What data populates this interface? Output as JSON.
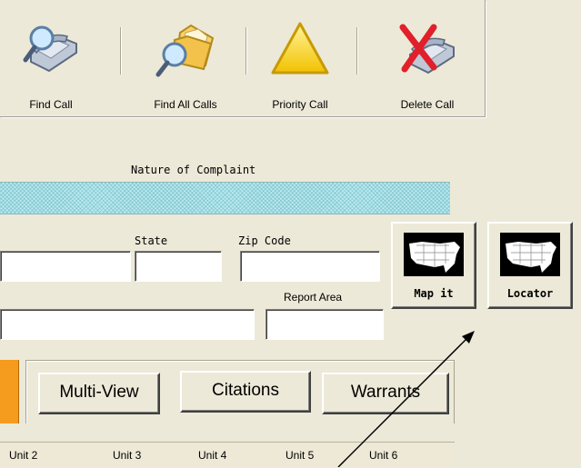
{
  "toolbar": {
    "buttons": [
      {
        "label": "Find Call",
        "icon": "phone-magnifier-icon"
      },
      {
        "label": "Find All Calls",
        "icon": "folder-magnifier-icon"
      },
      {
        "label": "Priority Call",
        "icon": "warning-triangle-icon"
      },
      {
        "label": "Delete Call",
        "icon": "phone-delete-icon"
      }
    ]
  },
  "form": {
    "nature_of_complaint_label": "Nature of Complaint",
    "nature_of_complaint_value": "",
    "state_label": "State",
    "state_value": "",
    "zip_label": "Zip Code",
    "zip_value": "",
    "address_value": "",
    "city_value": "",
    "report_area_label": "Report Area",
    "report_area_value": ""
  },
  "map_buttons": {
    "map_it": "Map it",
    "locator": "Locator"
  },
  "tabs": {
    "multi_view": "Multi-View",
    "citations": "Citations",
    "warrants": "Warrants"
  },
  "units": [
    "Unit 2",
    "Unit 3",
    "Unit 4",
    "Unit 5",
    "Unit 6"
  ],
  "colors": {
    "background": "#ece9d8",
    "complaint_field": "#b8eaf0",
    "active_tab": "#f59b1e",
    "priority_icon": "#f6d21a",
    "delete_x": "#e0202a"
  }
}
